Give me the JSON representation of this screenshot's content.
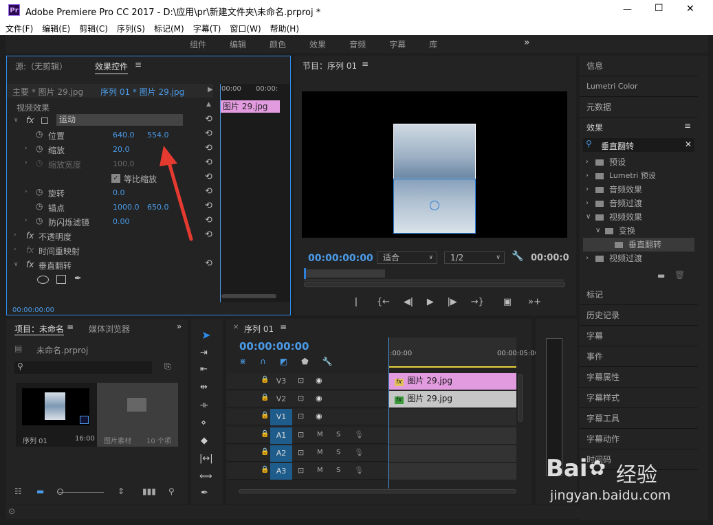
{
  "window": {
    "title": "Adobe Premiere Pro CC 2017 - D:\\应用\\pr\\新建文件夹\\未命名.prproj *",
    "logo": "Pr",
    "minimize": "—",
    "maximize": "☐",
    "close": "✕"
  },
  "menu": [
    "文件(F)",
    "编辑(E)",
    "剪辑(C)",
    "序列(S)",
    "标记(M)",
    "字幕(T)",
    "窗口(W)",
    "帮助(H)"
  ],
  "workspaces": [
    "组件",
    "编辑",
    "颜色",
    "效果",
    "音频",
    "字幕",
    "库"
  ],
  "workspaces_more": "»",
  "effect_controls": {
    "tab_source": "源:（无剪辑）",
    "tab_active": "效果控件",
    "menu_icon": "≡",
    "master": "主要 * 图片 29.jpg",
    "sequence": "序列 01 * 图片 29.jpg",
    "section": "视频效果",
    "motion": "运动",
    "position_label": "位置",
    "position_x": "640.0",
    "position_y": "554.0",
    "scale_label": "缩放",
    "scale_val": "20.0",
    "scale_width_label": "缩放宽度",
    "scale_width_val": "100.0",
    "uniform_label": "等比缩放",
    "rotation_label": "旋转",
    "rotation_val": "0.0",
    "anchor_label": "锚点",
    "anchor_x": "1000.0",
    "anchor_y": "650.0",
    "flicker_label": "防闪烁滤镜",
    "flicker_val": "0.00",
    "opacity_label": "不透明度",
    "timeremap_label": "时间重映射",
    "vflip_label": "垂直翻转",
    "timecode": "00:00:00:00",
    "mini_ruler_a": "00:00",
    "mini_ruler_b": "00:00:",
    "mini_clip": "图片 29.jpg"
  },
  "program": {
    "title": "节目：序列 01",
    "menu_icon": "≡",
    "timecode": "00:00:00:00",
    "fit": "适合",
    "resolution": "1/2",
    "right_timecode": "00:00:0"
  },
  "project": {
    "tab": "项目：未命名",
    "tab2": "媒体浏览器",
    "more": "»",
    "file": "未命名.prproj",
    "seq_name": "序列 01",
    "seq_dur": "16:00",
    "bin_name": "图片素材",
    "bin_count": "10 个项"
  },
  "timeline": {
    "title": "序列 01",
    "timecode": "00:00:00:00",
    "ruler_a": ":00:00",
    "ruler_b": "00:00:05:00",
    "tracks": [
      {
        "name": "V3",
        "sel": false
      },
      {
        "name": "V2",
        "sel": false
      },
      {
        "name": "V1",
        "sel": true
      }
    ],
    "audio": [
      "A1",
      "A2",
      "A3"
    ],
    "clip1": "图片 29.jpg",
    "clip2": "图片 29.jpg",
    "fx1": "fx",
    "fx2": "fx",
    "mute": "M",
    "solo": "S"
  },
  "right_panels": {
    "info": "信息",
    "lumetri": "Lumetri Color",
    "metadata": "元数据",
    "effects": "效果",
    "effects_menu": "≡",
    "search": "垂直翻转",
    "search_clear": "✕",
    "tree": [
      {
        "label": "预设",
        "indent": 0
      },
      {
        "label": "Lumetri 预设",
        "indent": 0
      },
      {
        "label": "音频效果",
        "indent": 0
      },
      {
        "label": "音频过渡",
        "indent": 0
      },
      {
        "label": "视频效果",
        "indent": 0,
        "open": true
      },
      {
        "label": "变换",
        "indent": 1,
        "open": true
      },
      {
        "label": "垂直翻转",
        "indent": 2,
        "sel": true
      },
      {
        "label": "视频过渡",
        "indent": 0
      }
    ],
    "list": [
      "标记",
      "历史记录",
      "字幕",
      "事件",
      "字幕属性",
      "字幕样式",
      "字幕工具",
      "字幕动作",
      "时间码"
    ]
  },
  "watermark": {
    "brand": "Bai",
    "brand2": "经验",
    "url": "jingyan.baidu.com"
  }
}
